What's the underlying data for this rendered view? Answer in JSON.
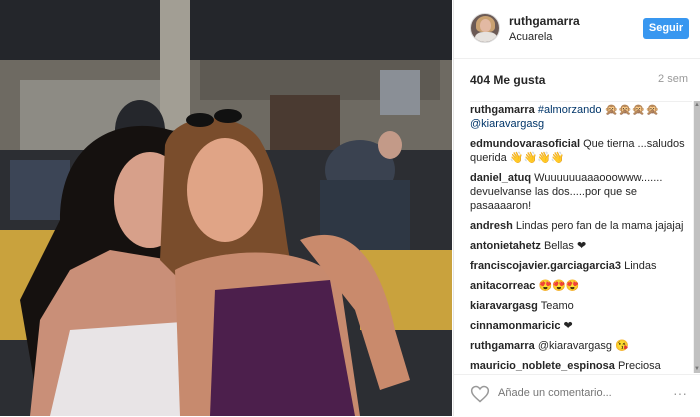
{
  "post": {
    "username": "ruthgamarra",
    "location": "Acuarela",
    "follow_label": "Seguir",
    "likes": "404 Me gusta",
    "time": "2 sem"
  },
  "comments": [
    {
      "user": "ruthgamarra",
      "text": "#almorzando",
      "extra": " 🙊🙊🙊🙊",
      "tag2": "@kiaravargasg"
    },
    {
      "user": "edmundovarasoficial",
      "text": " Que tierna ...saludos querida 👋👋👋👋"
    },
    {
      "user": "daniel_atuq",
      "text": " Wuuuuuuaaaooowww....... devuelvanse las dos.....por que se pasaaaaron!"
    },
    {
      "user": "andresh",
      "text": " Lindas pero fan de la mama jajajaj"
    },
    {
      "user": "antonietahetz",
      "text": " Bellas ❤"
    },
    {
      "user": "franciscojavier.garciagarcia3",
      "text": " Lindas"
    },
    {
      "user": "anitacorreac",
      "text": " 😍😍😍"
    },
    {
      "user": "kiaravargasg",
      "text": " Teamo"
    },
    {
      "user": "cinnamonmaricic",
      "text": " ❤"
    },
    {
      "user": "ruthgamarra",
      "text": " @kiaravargasg 😘"
    },
    {
      "user": "mauricio_noblete_espinosa",
      "text": " Preciosa"
    }
  ],
  "footer": {
    "comment_placeholder": "Añade un comentario...",
    "more": "···"
  },
  "icons": {
    "heart": "heart-outline-icon",
    "more": "more-options-icon"
  },
  "colors": {
    "follow_button": "#3897f0",
    "link": "#003569"
  }
}
